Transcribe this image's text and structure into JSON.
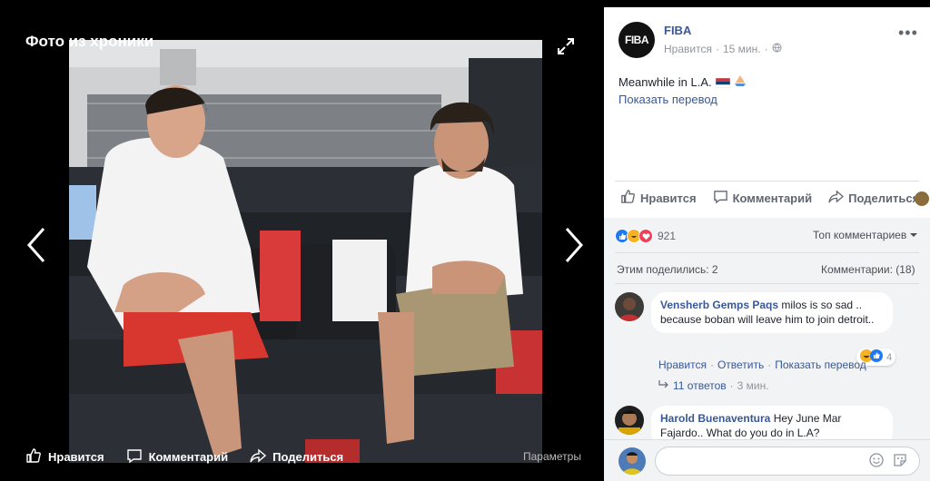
{
  "viewer": {
    "title": "Фото из хроники",
    "actions": {
      "like": "Нравится",
      "comment": "Комментарий",
      "share": "Поделиться"
    },
    "params": "Параметры"
  },
  "post": {
    "page_name": "FIBA",
    "logo_text": "FIBA",
    "like_label": "Нравится",
    "time": "15 мин.",
    "text": "Meanwhile in L.A.",
    "translate": "Показать перевод",
    "actions": {
      "like": "Нравится",
      "comment": "Комментарий",
      "share": "Поделиться"
    },
    "reaction_count": "921",
    "top_comments": "Топ комментариев",
    "shares": "Этим поделились: 2",
    "comments_count": "Комментарии: (18)"
  },
  "comments": [
    {
      "author": "Vensherb Gemps Paqs",
      "text": " milos is so sad .. because boban will leave him to join detroit..",
      "like": "Нравится",
      "reply": "Ответить",
      "translate": "Показать перевод",
      "reaction_count": "4",
      "replies": "11 ответов",
      "replies_time": "3 мин."
    },
    {
      "author": "Harold Buenaventura",
      "text": " Hey June Mar Fajardo.. What do you do in L.A?"
    }
  ],
  "composer": {
    "placeholder": ""
  },
  "colors": {
    "link": "#385898",
    "like_blue": "#2078f4",
    "love_red": "#f33e58",
    "haha_yellow": "#f7b125"
  },
  "icons": [
    "expand-icon",
    "arrow-left-icon",
    "arrow-right-icon",
    "thumbs-up-icon",
    "comment-icon",
    "share-icon",
    "globe-icon",
    "more-icon",
    "emoji-icon",
    "sticker-icon",
    "reply-arrow-icon",
    "chevron-down-icon"
  ]
}
